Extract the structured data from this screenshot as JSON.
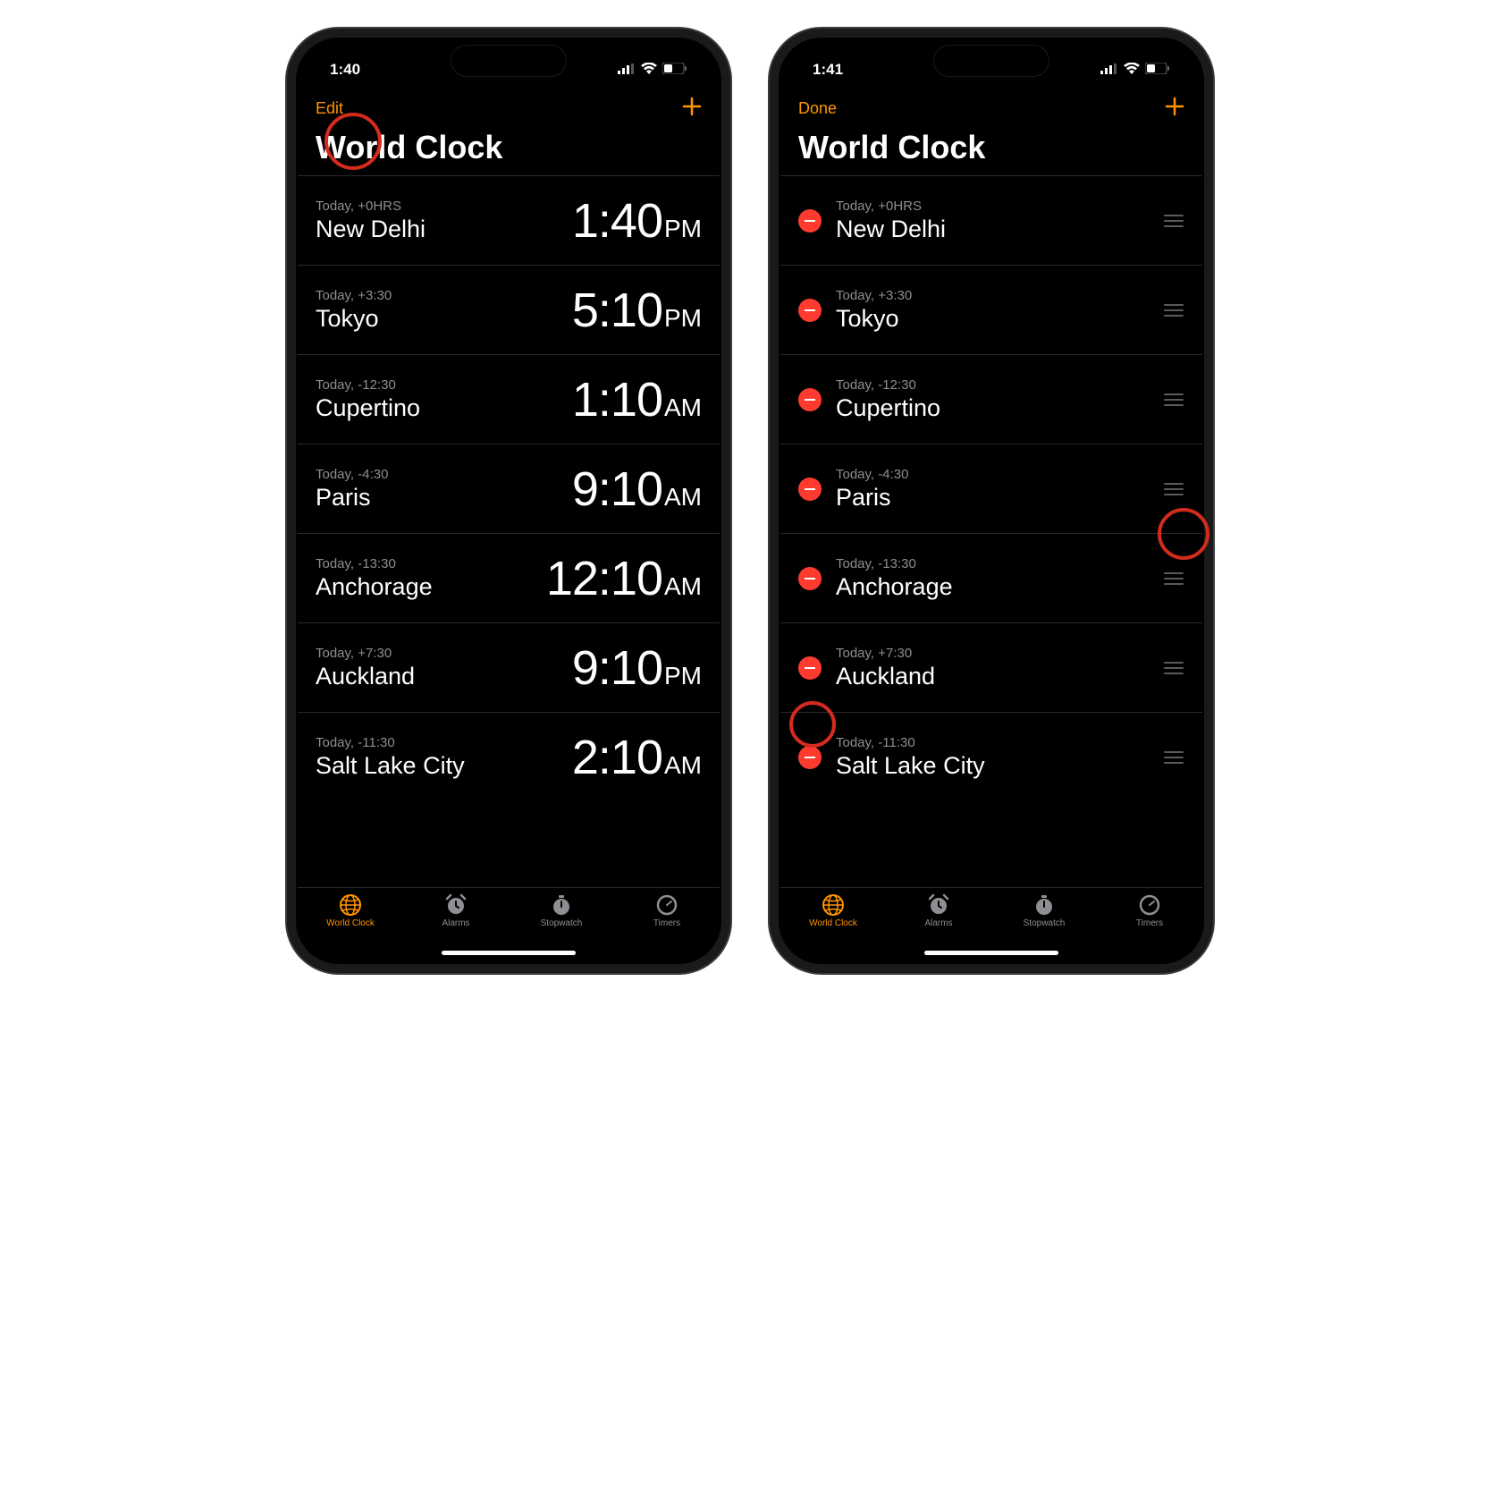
{
  "left": {
    "status_time": "1:40",
    "nav_left": "Edit",
    "title": "World Clock",
    "clocks": [
      {
        "sub": "Today, +0HRS",
        "city": "New Delhi",
        "time": "1:40",
        "ampm": "PM"
      },
      {
        "sub": "Today, +3:30",
        "city": "Tokyo",
        "time": "5:10",
        "ampm": "PM"
      },
      {
        "sub": "Today, -12:30",
        "city": "Cupertino",
        "time": "1:10",
        "ampm": "AM"
      },
      {
        "sub": "Today, -4:30",
        "city": "Paris",
        "time": "9:10",
        "ampm": "AM"
      },
      {
        "sub": "Today, -13:30",
        "city": "Anchorage",
        "time": "12:10",
        "ampm": "AM"
      },
      {
        "sub": "Today, +7:30",
        "city": "Auckland",
        "time": "9:10",
        "ampm": "PM"
      },
      {
        "sub": "Today, -11:30",
        "city": "Salt Lake City",
        "time": "2:10",
        "ampm": "AM"
      }
    ]
  },
  "right": {
    "status_time": "1:41",
    "nav_left": "Done",
    "title": "World Clock",
    "clocks": [
      {
        "sub": "Today, +0HRS",
        "city": "New Delhi"
      },
      {
        "sub": "Today, +3:30",
        "city": "Tokyo"
      },
      {
        "sub": "Today, -12:30",
        "city": "Cupertino"
      },
      {
        "sub": "Today, -4:30",
        "city": "Paris"
      },
      {
        "sub": "Today, -13:30",
        "city": "Anchorage"
      },
      {
        "sub": "Today, +7:30",
        "city": "Auckland"
      },
      {
        "sub": "Today, -11:30",
        "city": "Salt Lake City"
      }
    ]
  },
  "tabs": [
    {
      "label": "World Clock",
      "icon": "globe"
    },
    {
      "label": "Alarms",
      "icon": "alarm"
    },
    {
      "label": "Stopwatch",
      "icon": "stopwatch"
    },
    {
      "label": "Timers",
      "icon": "timer"
    }
  ],
  "colors": {
    "accent": "#ff9500",
    "delete": "#ff3b30",
    "highlight": "#d52b1e"
  }
}
